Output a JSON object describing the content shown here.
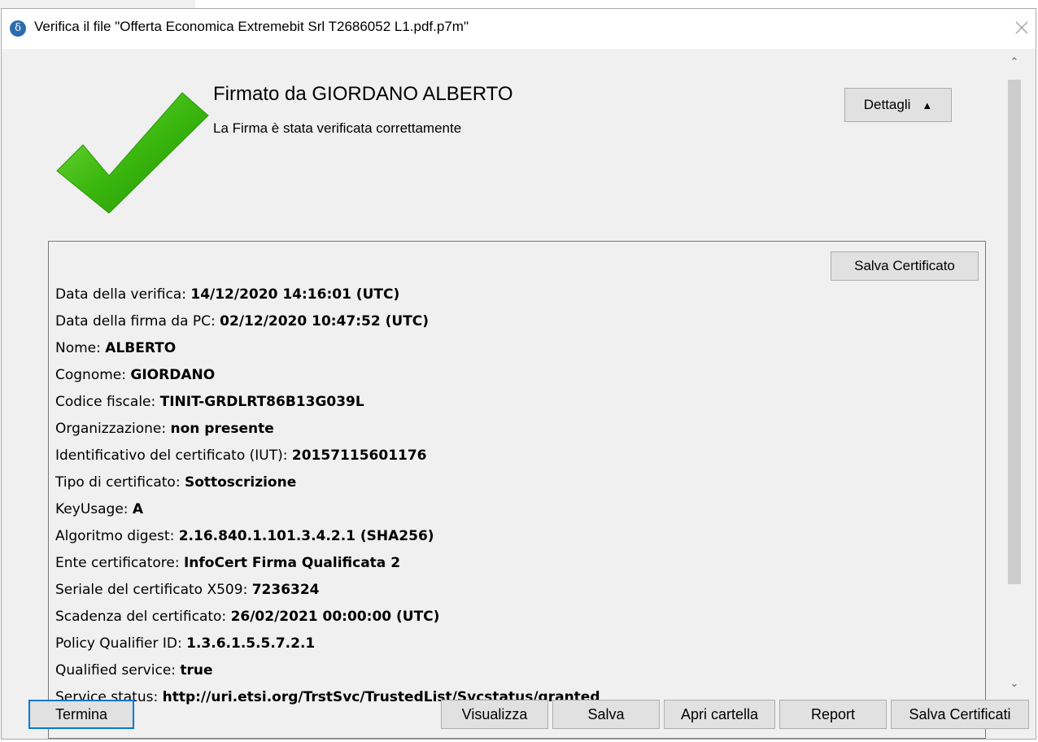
{
  "window": {
    "title": "Verifica il file \"Offerta Economica Extremebit Srl T2686052 L1.pdf.p7m\"",
    "app_icon_glyph": "δ",
    "accent_color": "#0078d7"
  },
  "result": {
    "title": "Firmato da GIORDANO ALBERTO",
    "subtitle": "La Firma è stata verificata correttamente",
    "status_icon": "check-mark-icon",
    "status_color": "#3cb80e"
  },
  "buttons": {
    "dettagli": "Dettagli",
    "dettagli_arrow": "▲",
    "salva_certificato": "Salva Certificato",
    "termina": "Termina",
    "visualizza": "Visualizza",
    "salva": "Salva",
    "apri_cartella": "Apri cartella",
    "report": "Report",
    "salva_certificati": "Salva Certificati"
  },
  "details": [
    {
      "label": "Data della verifica: ",
      "value": "14/12/2020 14:16:01 (UTC)"
    },
    {
      "label": "Data della firma da PC: ",
      "value": "02/12/2020 10:47:52 (UTC)"
    },
    {
      "label": "Nome: ",
      "value": "ALBERTO"
    },
    {
      "label": "Cognome: ",
      "value": "GIORDANO"
    },
    {
      "label": "Codice fiscale: ",
      "value": "TINIT-GRDLRT86B13G039L"
    },
    {
      "label": "Organizzazione: ",
      "value": "non presente"
    },
    {
      "label": "Identificativo del certificato (IUT): ",
      "value": "20157115601176"
    },
    {
      "label": "Tipo di certificato: ",
      "value": "Sottoscrizione"
    },
    {
      "label": "KeyUsage: ",
      "value": "A"
    },
    {
      "label": "Algoritmo digest: ",
      "value": "2.16.840.1.101.3.4.2.1 (SHA256)"
    },
    {
      "label": "Ente certificatore: ",
      "value": "InfoCert Firma Qualificata 2"
    },
    {
      "label": "Seriale del certificato X509: ",
      "value": "7236324"
    },
    {
      "label": "Scadenza del certificato: ",
      "value": "26/02/2021 00:00:00 (UTC)"
    },
    {
      "label": "Policy Qualifier ID: ",
      "value": "1.3.6.1.5.5.7.2.1"
    },
    {
      "label": "Qualified service: ",
      "value": "true"
    },
    {
      "label": "Service status: ",
      "value": "http://uri.etsi.org/TrstSvc/TrustedList/Svcstatus/granted"
    }
  ]
}
